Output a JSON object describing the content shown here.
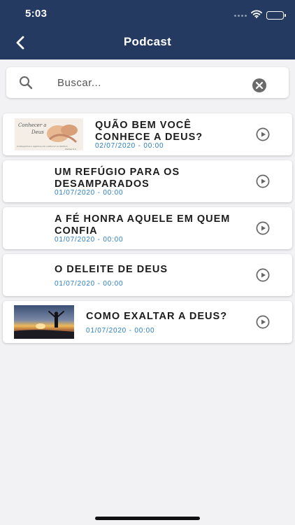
{
  "status_bar": {
    "time": "5:03"
  },
  "header": {
    "title": "Podcast"
  },
  "search": {
    "placeholder": "Buscar..."
  },
  "podcasts": [
    {
      "title": "QUÃO BEM VOCÊ CONHECE A DEUS?",
      "date": "02/07/2020 - 00:00",
      "thumbnail": "conhecer-a-deus",
      "thumb_caption_top": "Conhecer a Deus",
      "thumb_caption_bottom": "Conheçamos e sigamos em conhecer ao Senhor, Oséias 6.3"
    },
    {
      "title": "UM REFÚGIO PARA OS DESAMPARADOS",
      "date": "01/07/2020 - 00:00",
      "thumbnail": ""
    },
    {
      "title": "A FÉ HONRA AQUELE EM QUEM CONFIA",
      "date": "01/07/2020 - 00:00",
      "thumbnail": ""
    },
    {
      "title": "O DELEITE DE DEUS",
      "date": "01/07/2020 - 00:00",
      "thumbnail": ""
    },
    {
      "title": "COMO EXALTAR A DEUS?",
      "date": "01/07/2020 - 00:00",
      "thumbnail": "sunset-silhouette"
    }
  ],
  "colors": {
    "header_bg": "#253a60",
    "date_text": "#2a7ec4",
    "icon_gray": "#666666"
  },
  "icons": {
    "back": "chevron-left-icon",
    "search": "search-icon",
    "clear": "clear-circle-icon",
    "play": "play-circle-icon"
  }
}
